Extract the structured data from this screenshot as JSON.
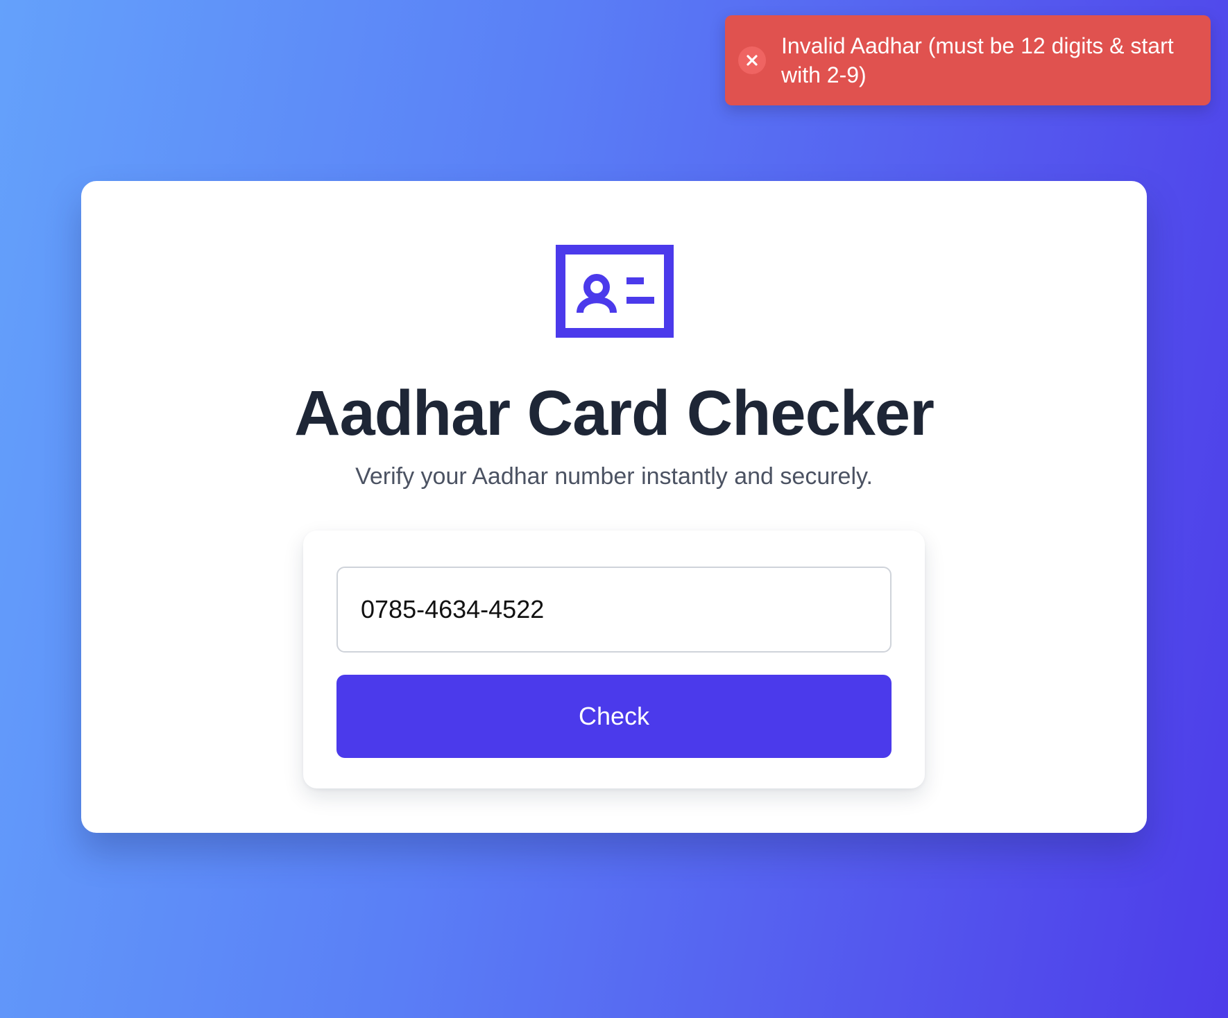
{
  "toast": {
    "icon": "close-circle-icon",
    "message": "Invalid Aadhar (must be 12 digits & start with 2-9)",
    "color": "#e0524f"
  },
  "card": {
    "logo_icon": "id-card-icon",
    "title": "Aadhar Card Checker",
    "subtitle": "Verify your Aadhar number instantly and securely."
  },
  "form": {
    "aadhar_value": "0785-4634-4522",
    "check_label": "Check",
    "accent_color": "#4b3aeb"
  }
}
